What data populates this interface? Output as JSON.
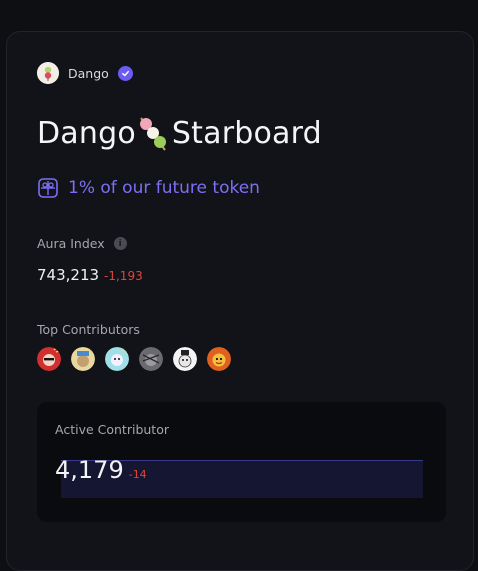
{
  "brand": {
    "name": "Dango",
    "verified": true,
    "avatar_icon": "dango-avatar-icon"
  },
  "title": {
    "part1": "Dango",
    "emoji_icon": "dango-skewer-icon",
    "part2": "Starboard"
  },
  "token": {
    "icon": "gift-icon",
    "text": "1% of our future token",
    "color": "#7d6ff5"
  },
  "aura": {
    "label": "Aura Index",
    "info_icon": "info-icon",
    "value": "743,213",
    "change": "-1,193"
  },
  "contributors": {
    "label": "Top Contributors",
    "avatars": [
      "contributor-avatar-1",
      "contributor-avatar-2",
      "contributor-avatar-3",
      "contributor-avatar-4",
      "contributor-avatar-5",
      "contributor-avatar-6"
    ]
  },
  "active": {
    "label": "Active Contributor",
    "value": "4,179",
    "change": "-14"
  },
  "colors": {
    "accent": "#6b5cf2",
    "negative": "#e0443c",
    "background": "#0e0f13"
  }
}
